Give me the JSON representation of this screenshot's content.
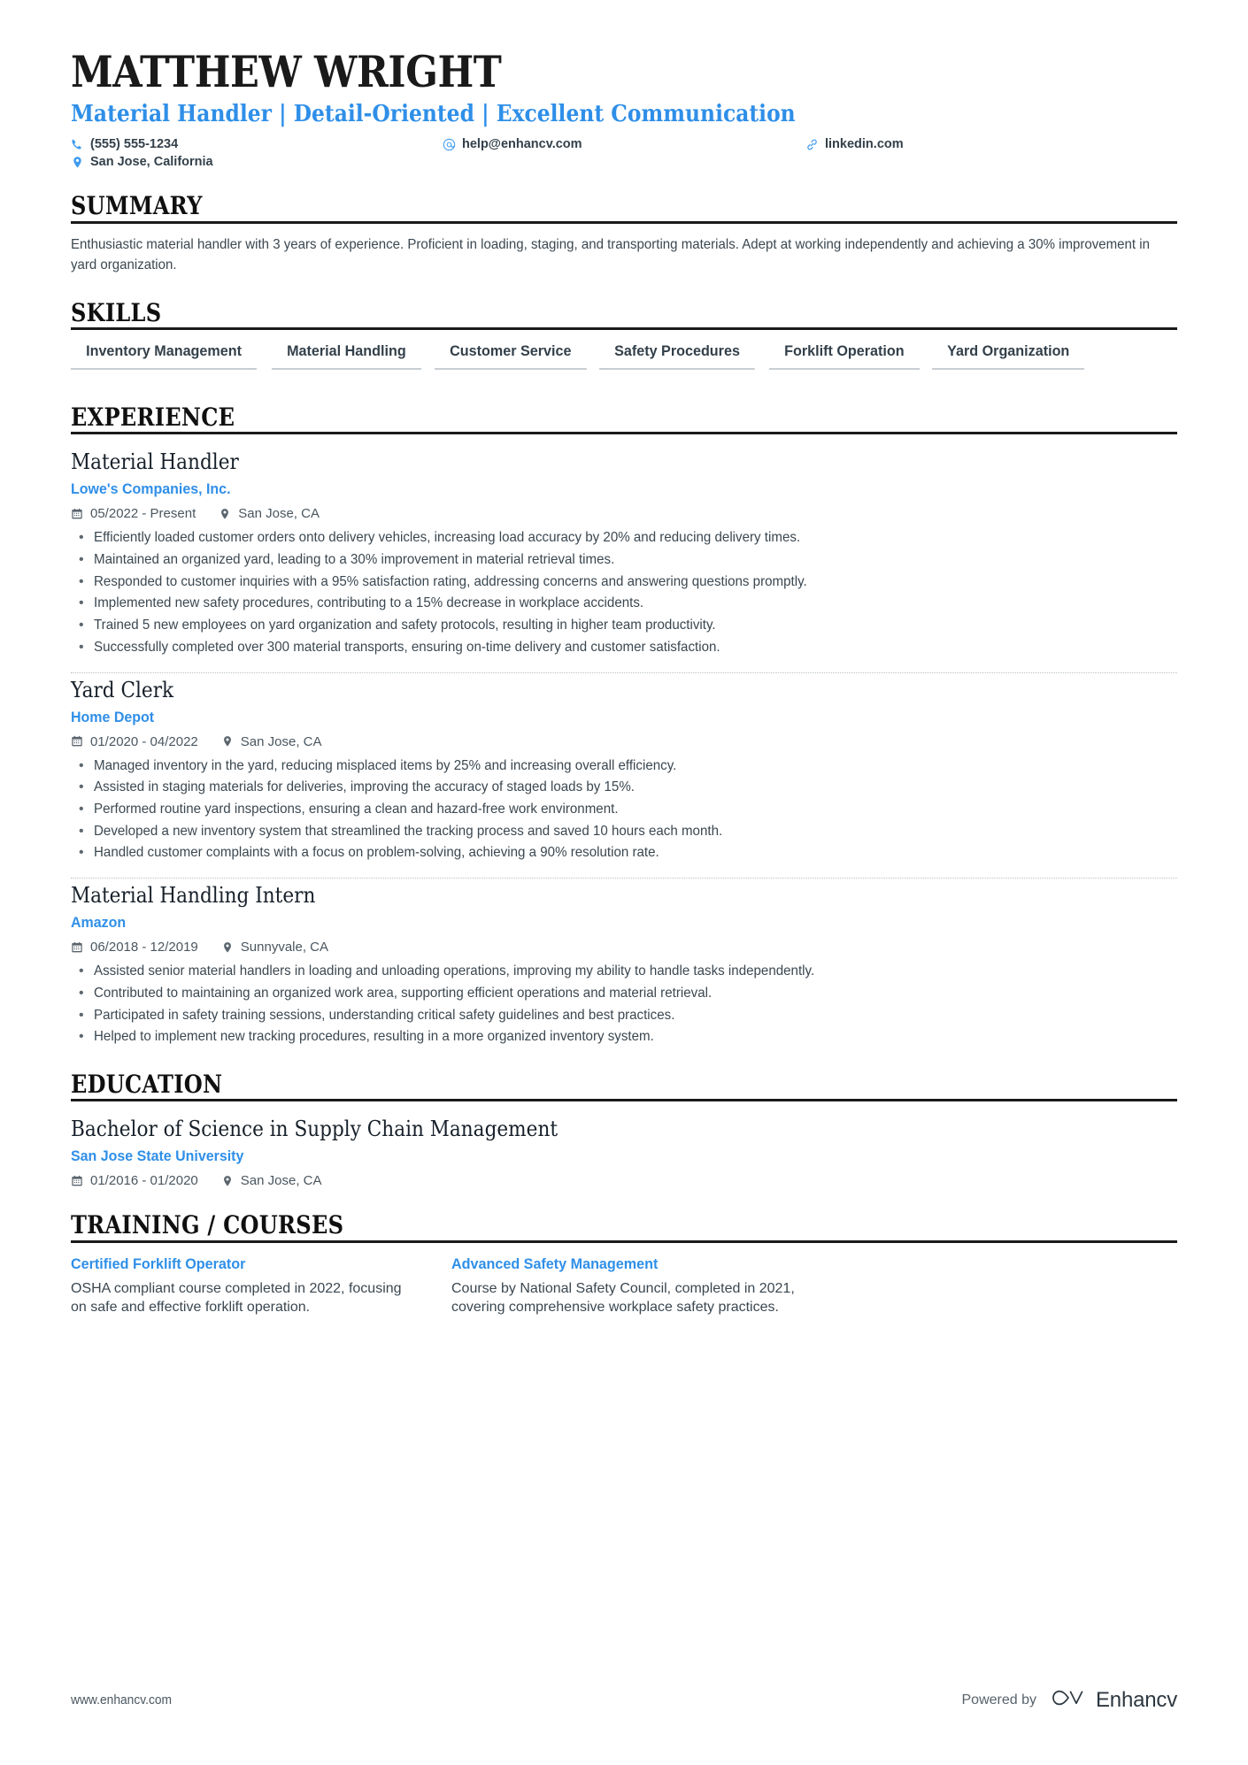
{
  "header": {
    "name": "MATTHEW WRIGHT",
    "headline": "Material Handler | Detail-Oriented | Excellent Communication",
    "contacts": [
      {
        "icon": "phone-icon",
        "label": "(555) 555-1234"
      },
      {
        "icon": "email-icon",
        "label": "help@enhancv.com"
      },
      {
        "icon": "link-icon",
        "label": "linkedin.com"
      },
      {
        "icon": "location-icon",
        "label": "San Jose, California"
      }
    ]
  },
  "summary": {
    "title": "SUMMARY",
    "text": "Enthusiastic material handler with 3 years of experience. Proficient in loading, staging, and transporting materials. Adept at working independently and achieving a 30% improvement in yard organization."
  },
  "skills": {
    "title": "SKILLS",
    "items": [
      "Inventory Management",
      "Material Handling",
      "Customer Service",
      "Safety Procedures",
      "Forklift Operation",
      "Yard Organization"
    ]
  },
  "experience": {
    "title": "EXPERIENCE",
    "jobs": [
      {
        "title": "Material Handler",
        "company": "Lowe's Companies, Inc.",
        "dates": "05/2022 - Present",
        "location": "San Jose, CA",
        "bullets": [
          "Efficiently loaded customer orders onto delivery vehicles, increasing load accuracy by 20% and reducing delivery times.",
          "Maintained an organized yard, leading to a 30% improvement in material retrieval times.",
          "Responded to customer inquiries with a 95% satisfaction rating, addressing concerns and answering questions promptly.",
          "Implemented new safety procedures, contributing to a 15% decrease in workplace accidents.",
          "Trained 5 new employees on yard organization and safety protocols, resulting in higher team productivity.",
          "Successfully completed over 300 material transports, ensuring on-time delivery and customer satisfaction."
        ]
      },
      {
        "title": "Yard Clerk",
        "company": "Home Depot",
        "dates": "01/2020 - 04/2022",
        "location": "San Jose, CA",
        "bullets": [
          "Managed inventory in the yard, reducing misplaced items by 25% and increasing overall efficiency.",
          "Assisted in staging materials for deliveries, improving the accuracy of staged loads by 15%.",
          "Performed routine yard inspections, ensuring a clean and hazard-free work environment.",
          "Developed a new inventory system that streamlined the tracking process and saved 10 hours each month.",
          "Handled customer complaints with a focus on problem-solving, achieving a 90% resolution rate."
        ]
      },
      {
        "title": "Material Handling Intern",
        "company": "Amazon",
        "dates": "06/2018 - 12/2019",
        "location": "Sunnyvale, CA",
        "bullets": [
          "Assisted senior material handlers in loading and unloading operations, improving my ability to handle tasks independently.",
          "Contributed to maintaining an organized work area, supporting efficient operations and material retrieval.",
          "Participated in safety training sessions, understanding critical safety guidelines and best practices.",
          "Helped to implement new tracking procedures, resulting in a more organized inventory system."
        ]
      }
    ]
  },
  "education": {
    "title": "EDUCATION",
    "entries": [
      {
        "degree": "Bachelor of Science in Supply Chain Management",
        "school": "San Jose State University",
        "dates": "01/2016 - 01/2020",
        "location": "San Jose, CA"
      }
    ]
  },
  "training": {
    "title": "TRAINING / COURSES",
    "courses": [
      {
        "name": "Certified Forklift Operator",
        "description": "OSHA compliant course completed in 2022, focusing on safe and effective forklift operation."
      },
      {
        "name": "Advanced Safety Management",
        "description": "Course by National Safety Council, completed in 2021, covering comprehensive workplace safety practices."
      }
    ]
  },
  "footer": {
    "url": "www.enhancv.com",
    "powered_by": "Powered by",
    "brand": "Enhancv"
  },
  "colors": {
    "accent": "#2f8fe8",
    "icon_accent": "#3d9bf0",
    "text": "#3b4750",
    "rule": "#1a1a1a"
  }
}
